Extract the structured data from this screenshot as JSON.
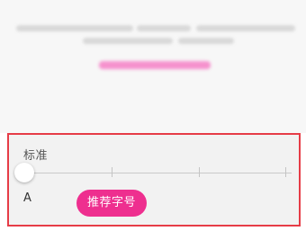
{
  "font_size_panel": {
    "label": "标准",
    "size_indicator": "A",
    "tooltip": "推荐字号"
  }
}
